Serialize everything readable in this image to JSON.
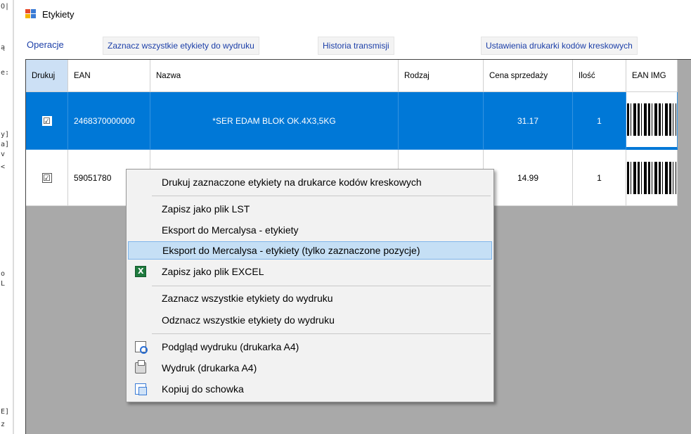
{
  "window": {
    "title": "Etykiety"
  },
  "background_glyphs": [
    "O|",
    "ą",
    "e:",
    "y]",
    "a]",
    "v",
    "<",
    "o",
    "L",
    "E]",
    "z"
  ],
  "menu": {
    "operations": "Operacje",
    "select_all": "Zaznacz wszystkie etykiety do wydruku",
    "history": "Historia transmisji",
    "printer_settings": "Ustawienia drukarki kodów kreskowych"
  },
  "grid": {
    "columns": [
      "Drukuj",
      "EAN",
      "Nazwa",
      "Rodzaj",
      "Cena sprzedaży",
      "Ilość",
      "EAN IMG"
    ],
    "rows": [
      {
        "print": "☑",
        "ean": "2468370000000",
        "name": "*SER EDAM BLOK OK.4X3,5KG",
        "type": "",
        "price": "31.17",
        "qty": "1",
        "selected": true
      },
      {
        "print": "☑",
        "ean": "59051780",
        "name": "",
        "type": "",
        "price": "14.99",
        "qty": "1",
        "selected": false
      }
    ]
  },
  "context_menu": {
    "items": [
      {
        "label": "Drukuj zaznaczone etykiety na drukarce kodów kreskowych",
        "icon": ""
      },
      {
        "label": "Zapisz jako plik LST",
        "icon": ""
      },
      {
        "label": "Eksport do Mercalysa - etykiety",
        "icon": ""
      },
      {
        "label": "Eksport do Mercalysa - etykiety (tylko zaznaczone pozycje)",
        "icon": "",
        "highlighted": true
      },
      {
        "label": "Zapisz jako plik EXCEL",
        "icon": "excel-icon"
      },
      {
        "label": "Zaznacz wszystkie etykiety do wydruku",
        "icon": ""
      },
      {
        "label": "Odznacz wszystkie etykiety do wydruku",
        "icon": ""
      },
      {
        "label": "Podgląd wydruku (drukarka A4)",
        "icon": "print-preview-icon"
      },
      {
        "label": "Wydruk (drukarka A4)",
        "icon": "printer-icon"
      },
      {
        "label": "Kopiuj do schowka",
        "icon": "copy-icon"
      }
    ]
  },
  "colors": {
    "selection": "#0078d7",
    "menu_text": "#1c3fa8",
    "highlight": "#c5dff5",
    "grid_bg": "#a9a9a9"
  }
}
